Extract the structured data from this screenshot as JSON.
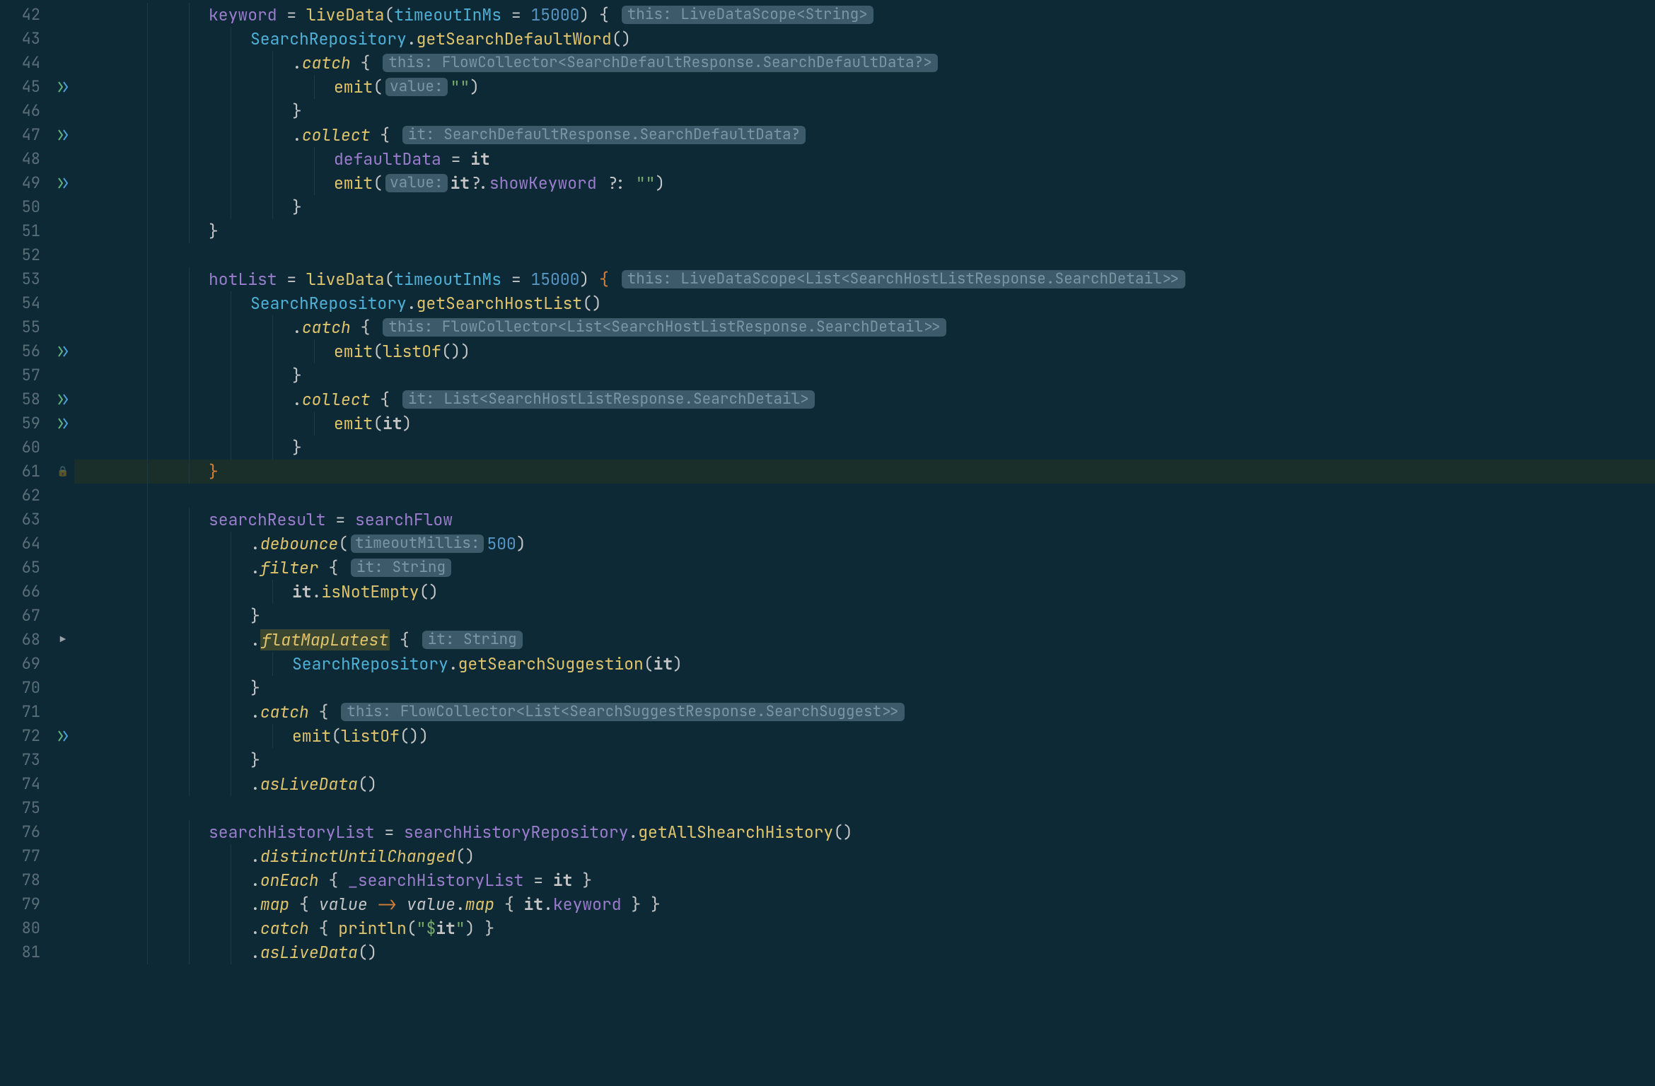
{
  "startLine": 42,
  "highlightedLine": 61,
  "iconLines": {
    "suspend": [
      45,
      47,
      49,
      56,
      58,
      59,
      72
    ],
    "play": [
      68
    ],
    "lock": [
      61
    ]
  },
  "lines": [
    {
      "n": 42,
      "indent": 2,
      "segs": [
        {
          "t": "field",
          "v": "keyword"
        },
        {
          "t": "plain",
          "v": " = "
        },
        {
          "t": "func",
          "v": "liveData"
        },
        {
          "t": "punc",
          "v": "("
        },
        {
          "t": "param",
          "v": "timeoutInMs"
        },
        {
          "t": "plain",
          "v": " = "
        },
        {
          "t": "num",
          "v": "15000"
        },
        {
          "t": "punc",
          "v": ") "
        },
        {
          "t": "brace",
          "v": "{ "
        },
        {
          "t": "hint",
          "v": "this: LiveDataScope<String>"
        }
      ]
    },
    {
      "n": 43,
      "indent": 3,
      "segs": [
        {
          "t": "type",
          "v": "SearchRepository"
        },
        {
          "t": "punc",
          "v": "."
        },
        {
          "t": "func",
          "v": "getSearchDefaultWord"
        },
        {
          "t": "punc",
          "v": "()"
        }
      ]
    },
    {
      "n": 44,
      "indent": 4,
      "segs": [
        {
          "t": "punc",
          "v": "."
        },
        {
          "t": "funcExt",
          "v": "catch"
        },
        {
          "t": "plain",
          "v": " "
        },
        {
          "t": "brace",
          "v": "{ "
        },
        {
          "t": "hint",
          "v": "this: FlowCollector<SearchDefaultResponse.SearchDefaultData?>"
        }
      ]
    },
    {
      "n": 45,
      "indent": 5,
      "segs": [
        {
          "t": "func",
          "v": "emit"
        },
        {
          "t": "punc",
          "v": "("
        },
        {
          "t": "hintSmall",
          "v": "value:"
        },
        {
          "t": "str",
          "v": "\"\""
        },
        {
          "t": "punc",
          "v": ")"
        }
      ]
    },
    {
      "n": 46,
      "indent": 4,
      "segs": [
        {
          "t": "brace",
          "v": "}"
        }
      ]
    },
    {
      "n": 47,
      "indent": 4,
      "segs": [
        {
          "t": "punc",
          "v": "."
        },
        {
          "t": "funcExt",
          "v": "collect"
        },
        {
          "t": "plain",
          "v": " "
        },
        {
          "t": "brace",
          "v": "{ "
        },
        {
          "t": "hint",
          "v": "it: SearchDefaultResponse.SearchDefaultData?"
        }
      ]
    },
    {
      "n": 48,
      "indent": 5,
      "segs": [
        {
          "t": "field",
          "v": "defaultData"
        },
        {
          "t": "plain",
          "v": " = "
        },
        {
          "t": "it",
          "v": "it"
        }
      ]
    },
    {
      "n": 49,
      "indent": 5,
      "segs": [
        {
          "t": "func",
          "v": "emit"
        },
        {
          "t": "punc",
          "v": "("
        },
        {
          "t": "hintSmall",
          "v": "value:"
        },
        {
          "t": "it",
          "v": "it"
        },
        {
          "t": "plain",
          "v": "?."
        },
        {
          "t": "field",
          "v": "showKeyword"
        },
        {
          "t": "plain",
          "v": " ?: "
        },
        {
          "t": "str",
          "v": "\"\""
        },
        {
          "t": "punc",
          "v": ")"
        }
      ]
    },
    {
      "n": 50,
      "indent": 4,
      "segs": [
        {
          "t": "brace",
          "v": "}"
        }
      ]
    },
    {
      "n": 51,
      "indent": 2,
      "segs": [
        {
          "t": "brace",
          "v": "}"
        }
      ]
    },
    {
      "n": 52,
      "indent": 0,
      "segs": []
    },
    {
      "n": 53,
      "indent": 2,
      "segs": [
        {
          "t": "field",
          "v": "hotList"
        },
        {
          "t": "plain",
          "v": " = "
        },
        {
          "t": "func",
          "v": "liveData"
        },
        {
          "t": "punc",
          "v": "("
        },
        {
          "t": "param",
          "v": "timeoutInMs"
        },
        {
          "t": "plain",
          "v": " = "
        },
        {
          "t": "num",
          "v": "15000"
        },
        {
          "t": "punc",
          "v": ") "
        },
        {
          "t": "braceO",
          "v": "{ "
        },
        {
          "t": "hint",
          "v": "this: LiveDataScope<List<SearchHostListResponse.SearchDetail>>"
        }
      ]
    },
    {
      "n": 54,
      "indent": 3,
      "segs": [
        {
          "t": "type",
          "v": "SearchRepository"
        },
        {
          "t": "punc",
          "v": "."
        },
        {
          "t": "func",
          "v": "getSearchHostList"
        },
        {
          "t": "punc",
          "v": "()"
        }
      ]
    },
    {
      "n": 55,
      "indent": 4,
      "segs": [
        {
          "t": "punc",
          "v": "."
        },
        {
          "t": "funcExt",
          "v": "catch"
        },
        {
          "t": "plain",
          "v": " "
        },
        {
          "t": "brace",
          "v": "{ "
        },
        {
          "t": "hint",
          "v": "this: FlowCollector<List<SearchHostListResponse.SearchDetail>>"
        }
      ]
    },
    {
      "n": 56,
      "indent": 5,
      "segs": [
        {
          "t": "func",
          "v": "emit"
        },
        {
          "t": "punc",
          "v": "("
        },
        {
          "t": "func",
          "v": "listOf"
        },
        {
          "t": "punc",
          "v": "())"
        }
      ]
    },
    {
      "n": 57,
      "indent": 4,
      "segs": [
        {
          "t": "brace",
          "v": "}"
        }
      ]
    },
    {
      "n": 58,
      "indent": 4,
      "segs": [
        {
          "t": "punc",
          "v": "."
        },
        {
          "t": "funcExt",
          "v": "collect"
        },
        {
          "t": "plain",
          "v": " "
        },
        {
          "t": "brace",
          "v": "{ "
        },
        {
          "t": "hint",
          "v": "it: List<SearchHostListResponse.SearchDetail>"
        }
      ]
    },
    {
      "n": 59,
      "indent": 5,
      "segs": [
        {
          "t": "func",
          "v": "emit"
        },
        {
          "t": "punc",
          "v": "("
        },
        {
          "t": "it",
          "v": "it"
        },
        {
          "t": "punc",
          "v": ")"
        }
      ]
    },
    {
      "n": 60,
      "indent": 4,
      "segs": [
        {
          "t": "brace",
          "v": "}"
        }
      ]
    },
    {
      "n": 61,
      "indent": 2,
      "segs": [
        {
          "t": "braceO",
          "v": "}"
        }
      ]
    },
    {
      "n": 62,
      "indent": 0,
      "segs": []
    },
    {
      "n": 63,
      "indent": 2,
      "segs": [
        {
          "t": "field",
          "v": "searchResult"
        },
        {
          "t": "plain",
          "v": " = "
        },
        {
          "t": "field",
          "v": "searchFlow"
        }
      ]
    },
    {
      "n": 64,
      "indent": 3,
      "segs": [
        {
          "t": "punc",
          "v": "."
        },
        {
          "t": "funcExt",
          "v": "debounce"
        },
        {
          "t": "punc",
          "v": "("
        },
        {
          "t": "hintSmall",
          "v": "timeoutMillis:"
        },
        {
          "t": "num",
          "v": "500"
        },
        {
          "t": "punc",
          "v": ")"
        }
      ]
    },
    {
      "n": 65,
      "indent": 3,
      "segs": [
        {
          "t": "punc",
          "v": "."
        },
        {
          "t": "funcExt",
          "v": "filter"
        },
        {
          "t": "plain",
          "v": " "
        },
        {
          "t": "brace",
          "v": "{ "
        },
        {
          "t": "hint",
          "v": "it: String"
        }
      ]
    },
    {
      "n": 66,
      "indent": 4,
      "segs": [
        {
          "t": "it",
          "v": "it"
        },
        {
          "t": "punc",
          "v": "."
        },
        {
          "t": "func",
          "v": "isNotEmpty"
        },
        {
          "t": "punc",
          "v": "()"
        }
      ]
    },
    {
      "n": 67,
      "indent": 3,
      "segs": [
        {
          "t": "brace",
          "v": "}"
        }
      ]
    },
    {
      "n": 68,
      "indent": 3,
      "segs": [
        {
          "t": "punc",
          "v": "."
        },
        {
          "t": "flatmap",
          "v": "flatMapLatest"
        },
        {
          "t": "plain",
          "v": " "
        },
        {
          "t": "brace",
          "v": "{ "
        },
        {
          "t": "hint",
          "v": "it: String"
        }
      ]
    },
    {
      "n": 69,
      "indent": 4,
      "segs": [
        {
          "t": "type",
          "v": "SearchRepository"
        },
        {
          "t": "punc",
          "v": "."
        },
        {
          "t": "func",
          "v": "getSearchSuggestion"
        },
        {
          "t": "punc",
          "v": "("
        },
        {
          "t": "it",
          "v": "it"
        },
        {
          "t": "punc",
          "v": ")"
        }
      ]
    },
    {
      "n": 70,
      "indent": 3,
      "segs": [
        {
          "t": "brace",
          "v": "}"
        }
      ]
    },
    {
      "n": 71,
      "indent": 3,
      "segs": [
        {
          "t": "punc",
          "v": "."
        },
        {
          "t": "funcExt",
          "v": "catch"
        },
        {
          "t": "plain",
          "v": " "
        },
        {
          "t": "brace",
          "v": "{ "
        },
        {
          "t": "hint",
          "v": "this: FlowCollector<List<SearchSuggestResponse.SearchSuggest>>"
        }
      ]
    },
    {
      "n": 72,
      "indent": 4,
      "segs": [
        {
          "t": "func",
          "v": "emit"
        },
        {
          "t": "punc",
          "v": "("
        },
        {
          "t": "func",
          "v": "listOf"
        },
        {
          "t": "punc",
          "v": "())"
        }
      ]
    },
    {
      "n": 73,
      "indent": 3,
      "segs": [
        {
          "t": "brace",
          "v": "}"
        }
      ]
    },
    {
      "n": 74,
      "indent": 3,
      "segs": [
        {
          "t": "punc",
          "v": "."
        },
        {
          "t": "funcExt",
          "v": "asLiveData"
        },
        {
          "t": "punc",
          "v": "()"
        }
      ]
    },
    {
      "n": 75,
      "indent": 0,
      "segs": []
    },
    {
      "n": 76,
      "indent": 2,
      "segs": [
        {
          "t": "field",
          "v": "searchHistoryList"
        },
        {
          "t": "plain",
          "v": " = "
        },
        {
          "t": "field",
          "v": "searchHistoryRepository"
        },
        {
          "t": "punc",
          "v": "."
        },
        {
          "t": "func",
          "v": "getAllShearchHistory"
        },
        {
          "t": "punc",
          "v": "()"
        }
      ]
    },
    {
      "n": 77,
      "indent": 3,
      "segs": [
        {
          "t": "punc",
          "v": "."
        },
        {
          "t": "funcExt",
          "v": "distinctUntilChanged"
        },
        {
          "t": "punc",
          "v": "()"
        }
      ]
    },
    {
      "n": 78,
      "indent": 3,
      "segs": [
        {
          "t": "punc",
          "v": "."
        },
        {
          "t": "funcExt",
          "v": "onEach"
        },
        {
          "t": "plain",
          "v": " "
        },
        {
          "t": "brace",
          "v": "{ "
        },
        {
          "t": "field",
          "v": "_searchHistoryList"
        },
        {
          "t": "plain",
          "v": " = "
        },
        {
          "t": "it",
          "v": "it"
        },
        {
          "t": "plain",
          "v": " "
        },
        {
          "t": "brace",
          "v": "}"
        }
      ]
    },
    {
      "n": 79,
      "indent": 3,
      "segs": [
        {
          "t": "punc",
          "v": "."
        },
        {
          "t": "funcExt",
          "v": "map"
        },
        {
          "t": "plain",
          "v": " "
        },
        {
          "t": "brace",
          "v": "{ "
        },
        {
          "t": "paramName",
          "v": "value"
        },
        {
          "t": "plain",
          "v": " "
        },
        {
          "t": "kw",
          "v": "->"
        },
        {
          "t": "plain",
          "v": " "
        },
        {
          "t": "paramName",
          "v": "value"
        },
        {
          "t": "punc",
          "v": "."
        },
        {
          "t": "funcExt",
          "v": "map"
        },
        {
          "t": "plain",
          "v": " "
        },
        {
          "t": "brace",
          "v": "{ "
        },
        {
          "t": "it",
          "v": "it"
        },
        {
          "t": "punc",
          "v": "."
        },
        {
          "t": "field",
          "v": "keyword"
        },
        {
          "t": "plain",
          "v": " "
        },
        {
          "t": "brace",
          "v": "} }"
        }
      ]
    },
    {
      "n": 80,
      "indent": 3,
      "segs": [
        {
          "t": "punc",
          "v": "."
        },
        {
          "t": "funcExt",
          "v": "catch"
        },
        {
          "t": "plain",
          "v": " "
        },
        {
          "t": "brace",
          "v": "{ "
        },
        {
          "t": "func",
          "v": "println"
        },
        {
          "t": "punc",
          "v": "("
        },
        {
          "t": "str",
          "v": "\"$"
        },
        {
          "t": "it",
          "v": "it"
        },
        {
          "t": "str",
          "v": "\""
        },
        {
          "t": "punc",
          "v": ") "
        },
        {
          "t": "brace",
          "v": "}"
        }
      ]
    },
    {
      "n": 81,
      "indent": 3,
      "segs": [
        {
          "t": "punc",
          "v": "."
        },
        {
          "t": "funcExt",
          "v": "asLiveData"
        },
        {
          "t": "punc",
          "v": "()"
        }
      ]
    }
  ]
}
